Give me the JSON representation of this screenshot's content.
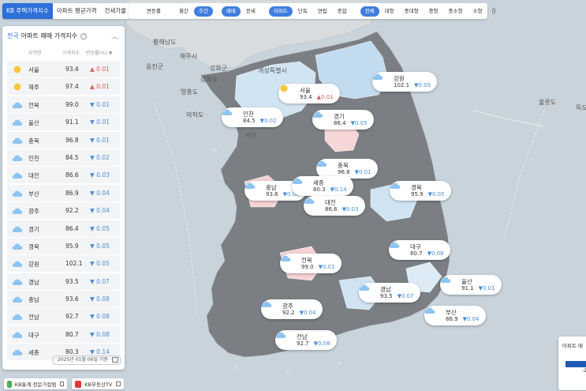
{
  "top_tabs": [
    {
      "label": "KB 주택가격지수",
      "active": true
    },
    {
      "label": "아파트 평균가격",
      "active": false
    },
    {
      "label": "전세가율",
      "active": false
    }
  ],
  "filters": {
    "toggle_label": "변동률",
    "period": [
      {
        "label": "월간",
        "active": false
      },
      {
        "label": "주간",
        "active": true
      }
    ],
    "trade": [
      {
        "label": "매매",
        "active": true
      },
      {
        "label": "전세",
        "active": false
      }
    ],
    "type": [
      {
        "label": "아파트",
        "active": true
      },
      {
        "label": "단독",
        "active": false
      },
      {
        "label": "연립",
        "active": false
      },
      {
        "label": "종합",
        "active": false
      }
    ],
    "size": [
      {
        "label": "전체",
        "active": true
      },
      {
        "label": "대형",
        "active": false
      },
      {
        "label": "중대형",
        "active": false
      },
      {
        "label": "중형",
        "active": false
      },
      {
        "label": "중소형",
        "active": false
      },
      {
        "label": "소형",
        "active": false
      }
    ]
  },
  "panel": {
    "region": "전국",
    "title": "아파트 매매 가격지수",
    "col_region": "지역명",
    "col_index": "가격지수",
    "col_change": "변동률(%) ▼",
    "rows": [
      {
        "name": "서울",
        "value": "93.4",
        "change": "0.01",
        "dir": "up",
        "weather": "sun"
      },
      {
        "name": "제주",
        "value": "97.4",
        "change": "0.01",
        "dir": "up",
        "weather": "sun"
      },
      {
        "name": "전북",
        "value": "99.0",
        "change": "0.01",
        "dir": "down",
        "weather": "cloud"
      },
      {
        "name": "울산",
        "value": "91.1",
        "change": "0.01",
        "dir": "down",
        "weather": "cloud"
      },
      {
        "name": "충북",
        "value": "96.8",
        "change": "0.01",
        "dir": "down",
        "weather": "cloud"
      },
      {
        "name": "인천",
        "value": "84.5",
        "change": "0.02",
        "dir": "down",
        "weather": "cloud"
      },
      {
        "name": "대전",
        "value": "86.6",
        "change": "0.03",
        "dir": "down",
        "weather": "cloud"
      },
      {
        "name": "부산",
        "value": "86.9",
        "change": "0.04",
        "dir": "down",
        "weather": "cloud"
      },
      {
        "name": "광주",
        "value": "92.2",
        "change": "0.04",
        "dir": "down",
        "weather": "cloud"
      },
      {
        "name": "경기",
        "value": "86.4",
        "change": "0.05",
        "dir": "down",
        "weather": "cloud"
      },
      {
        "name": "경북",
        "value": "95.9",
        "change": "0.05",
        "dir": "down",
        "weather": "cloud"
      },
      {
        "name": "강원",
        "value": "102.1",
        "change": "0.05",
        "dir": "down",
        "weather": "cloud"
      },
      {
        "name": "경남",
        "value": "93.5",
        "change": "0.07",
        "dir": "down",
        "weather": "cloud"
      },
      {
        "name": "충남",
        "value": "93.6",
        "change": "0.08",
        "dir": "down",
        "weather": "cloud"
      },
      {
        "name": "전남",
        "value": "92.7",
        "value2": "",
        "change": "0.08",
        "dir": "down",
        "weather": "cloud"
      },
      {
        "name": "대구",
        "value": "80.7",
        "change": "0.08",
        "dir": "down",
        "weather": "cloud"
      },
      {
        "name": "세종",
        "value": "80.3",
        "change": "0.14",
        "dir": "down",
        "weather": "cloud"
      }
    ],
    "date": "2025년 01월 06일 기준"
  },
  "bottom_links": [
    {
      "label": "KB통계 전문가칼럼",
      "badge_color": "#4caf50"
    },
    {
      "label": "KB부동산TV",
      "badge_color": "#e53935"
    }
  ],
  "map_markers": [
    {
      "name": "강원",
      "value": "102.1",
      "change": "0.05",
      "dir": "down",
      "weather": "cloud"
    },
    {
      "name": "서울",
      "value": "93.4",
      "change": "0.01",
      "dir": "up",
      "weather": "sun"
    },
    {
      "name": "인천",
      "value": "84.5",
      "change": "0.02",
      "dir": "down",
      "weather": "cloud"
    },
    {
      "name": "경기",
      "value": "86.4",
      "change": "0.05",
      "dir": "down",
      "weather": "cloud"
    },
    {
      "name": "충북",
      "value": "96.8",
      "change": "0.01",
      "dir": "down",
      "weather": "cloud"
    },
    {
      "name": "충남",
      "value": "93.6",
      "change": "0.08",
      "dir": "down",
      "weather": "cloud"
    },
    {
      "name": "세종",
      "value": "80.3",
      "change": "0.14",
      "dir": "down",
      "weather": "cloud"
    },
    {
      "name": "경북",
      "value": "95.9",
      "change": "0.05",
      "dir": "down",
      "weather": "cloud"
    },
    {
      "name": "대전",
      "value": "86.6",
      "change": "0.03",
      "dir": "down",
      "weather": "cloud"
    },
    {
      "name": "대구",
      "value": "80.7",
      "change": "0.08",
      "dir": "down",
      "weather": "cloud"
    },
    {
      "name": "전북",
      "value": "99.0",
      "change": "0.01",
      "dir": "down",
      "weather": "cloud"
    },
    {
      "name": "울산",
      "value": "91.1",
      "change": "0.01",
      "dir": "down",
      "weather": "cloud"
    },
    {
      "name": "경남",
      "value": "93.5",
      "change": "0.07",
      "dir": "down",
      "weather": "cloud"
    },
    {
      "name": "광주",
      "value": "92.2",
      "change": "0.04",
      "dir": "down",
      "weather": "cloud"
    },
    {
      "name": "부산",
      "value": "86.9",
      "change": "0.04",
      "dir": "down",
      "weather": "cloud"
    },
    {
      "name": "전남",
      "value": "92.7",
      "change": "0.08",
      "dir": "down",
      "weather": "cloud"
    }
  ],
  "map_labels": [
    "황해남도",
    "해주시",
    "옹진군",
    "강화군",
    "개성특별시",
    "강화도",
    "영흥도",
    "덕적도",
    "서산",
    "울릉도",
    "독도"
  ],
  "legend": {
    "title": "아파트 매",
    "value": "-2"
  },
  "colors": {
    "accent": "#2e6fd8",
    "up": "#e05b5b",
    "down": "#4a8fd6"
  }
}
